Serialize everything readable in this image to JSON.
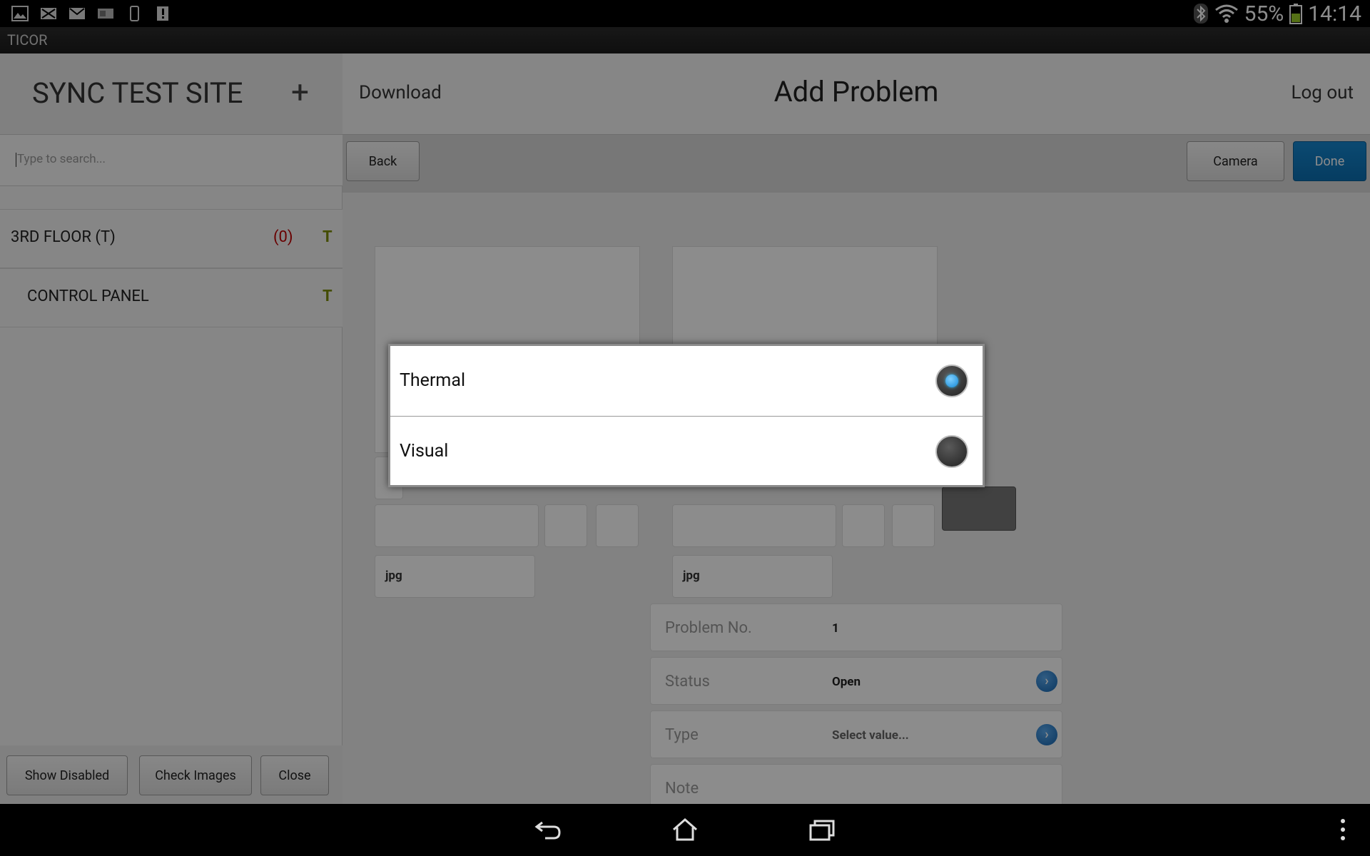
{
  "status_bar": {
    "battery_percent": "55%",
    "time": "14:14",
    "notification_icons": [
      "image-icon",
      "email-x-icon",
      "mail-icon",
      "card-icon",
      "phone-icon",
      "sd-alert-icon"
    ],
    "system_icons": [
      "bluetooth-icon",
      "wifi-icon",
      "battery-icon"
    ]
  },
  "app": {
    "title": "TICOR"
  },
  "sidebar": {
    "site_title": "SYNC TEST SITE",
    "add_label": "+",
    "search_placeholder": "Type to search...",
    "items": [
      {
        "label": "3RD FLOOR (T)",
        "count": "(0)",
        "flag": "T"
      },
      {
        "label": "CONTROL PANEL",
        "count": "",
        "flag": "T"
      }
    ],
    "footer_buttons": {
      "show_disabled": "Show Disabled",
      "check_images": "Check Images",
      "close": "Close"
    }
  },
  "header": {
    "download": "Download",
    "title": "Add Problem",
    "logout": "Log out"
  },
  "toolbar": {
    "back": "Back",
    "camera": "Camera",
    "done": "Done"
  },
  "images": [
    {
      "format": "jpg"
    },
    {
      "format": "jpg"
    }
  ],
  "form": {
    "problem_no": {
      "label": "Problem No.",
      "value": "1"
    },
    "status": {
      "label": "Status",
      "value": "Open"
    },
    "type": {
      "label": "Type",
      "placeholder": "Select value..."
    },
    "note": {
      "label": "Note"
    }
  },
  "dialog": {
    "options": [
      {
        "label": "Thermal",
        "selected": true
      },
      {
        "label": "Visual",
        "selected": false
      }
    ]
  },
  "colors": {
    "accent_blue": "#0b6fb1",
    "count_red": "#c00000",
    "flag_olive": "#7a8a00",
    "radio_blue": "#33b5e5"
  }
}
